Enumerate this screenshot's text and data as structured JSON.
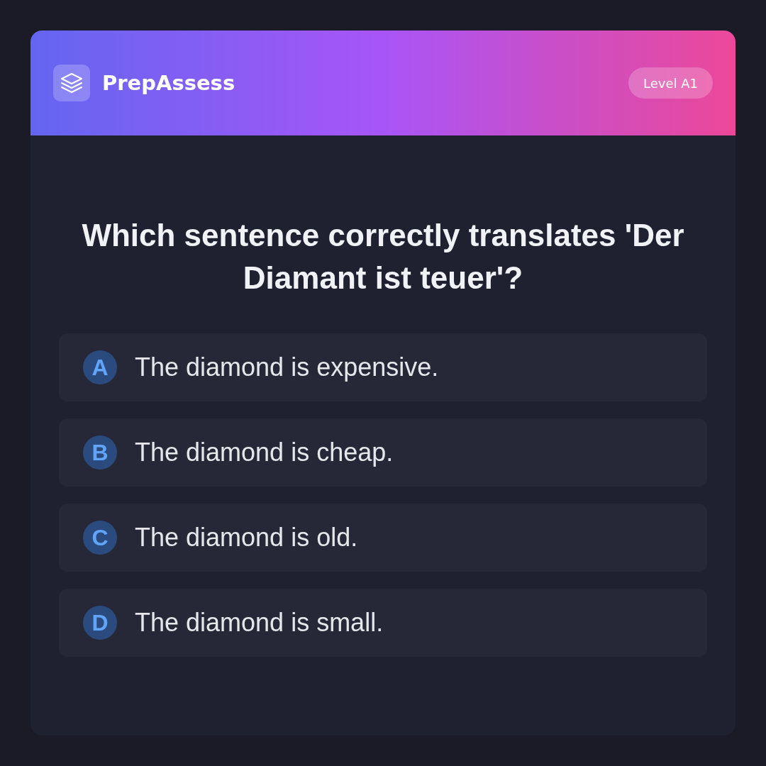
{
  "header": {
    "brand": "PrepAssess",
    "level_badge": "Level A1"
  },
  "question": "Which sentence correctly translates 'Der Diamant ist teuer'?",
  "options": [
    {
      "letter": "A",
      "text": "The diamond is expensive.",
      "selected": false
    },
    {
      "letter": "B",
      "text": "The diamond is cheap.",
      "selected": false
    },
    {
      "letter": "C",
      "text": "The diamond is old.",
      "selected": false
    },
    {
      "letter": "D",
      "text": "The diamond is small.",
      "selected": false
    }
  ]
}
